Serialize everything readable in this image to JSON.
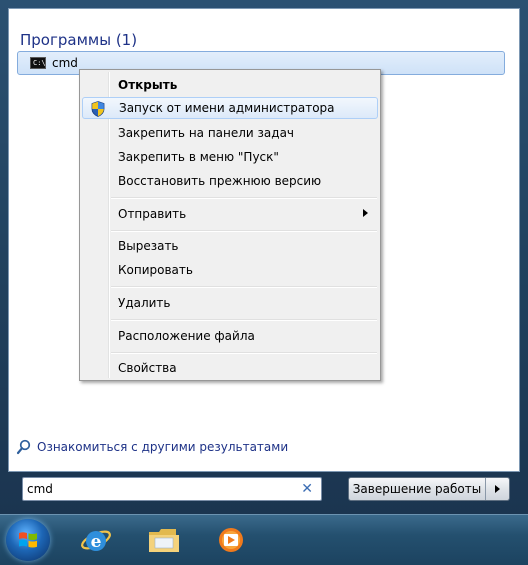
{
  "programs": {
    "section_title": "Программы (1)",
    "result_label": "cmd",
    "result_icon": "cmd-icon"
  },
  "context_menu": {
    "items": [
      {
        "label": "Открыть",
        "bold": true
      },
      {
        "label": "Запуск от имени администратора",
        "icon": "uac-shield-icon",
        "highlighted": true
      },
      {
        "label": "Закрепить на панели задач"
      },
      {
        "label": "Закрепить в меню \"Пуск\""
      },
      {
        "label": "Восстановить прежнюю версию"
      },
      {
        "label": "Отправить",
        "submenu": true
      },
      {
        "label": "Вырезать"
      },
      {
        "label": "Копировать"
      },
      {
        "label": "Удалить"
      },
      {
        "label": "Расположение файла"
      },
      {
        "label": "Свойства"
      }
    ]
  },
  "more_results": {
    "label": "Ознакомиться с другими результатами",
    "icon": "search-icon"
  },
  "search": {
    "value": "cmd",
    "clear_icon": "clear-icon"
  },
  "shutdown": {
    "label": "Завершение работы",
    "arrow_icon": "chevron-right-icon"
  },
  "taskbar": {
    "icons": [
      "windows-start-icon",
      "internet-explorer-icon",
      "folder-icon",
      "media-player-icon"
    ]
  },
  "colors": {
    "link_blue": "#1e3287",
    "highlight_border": "#aecff7",
    "frame_dark": "#21425f"
  }
}
